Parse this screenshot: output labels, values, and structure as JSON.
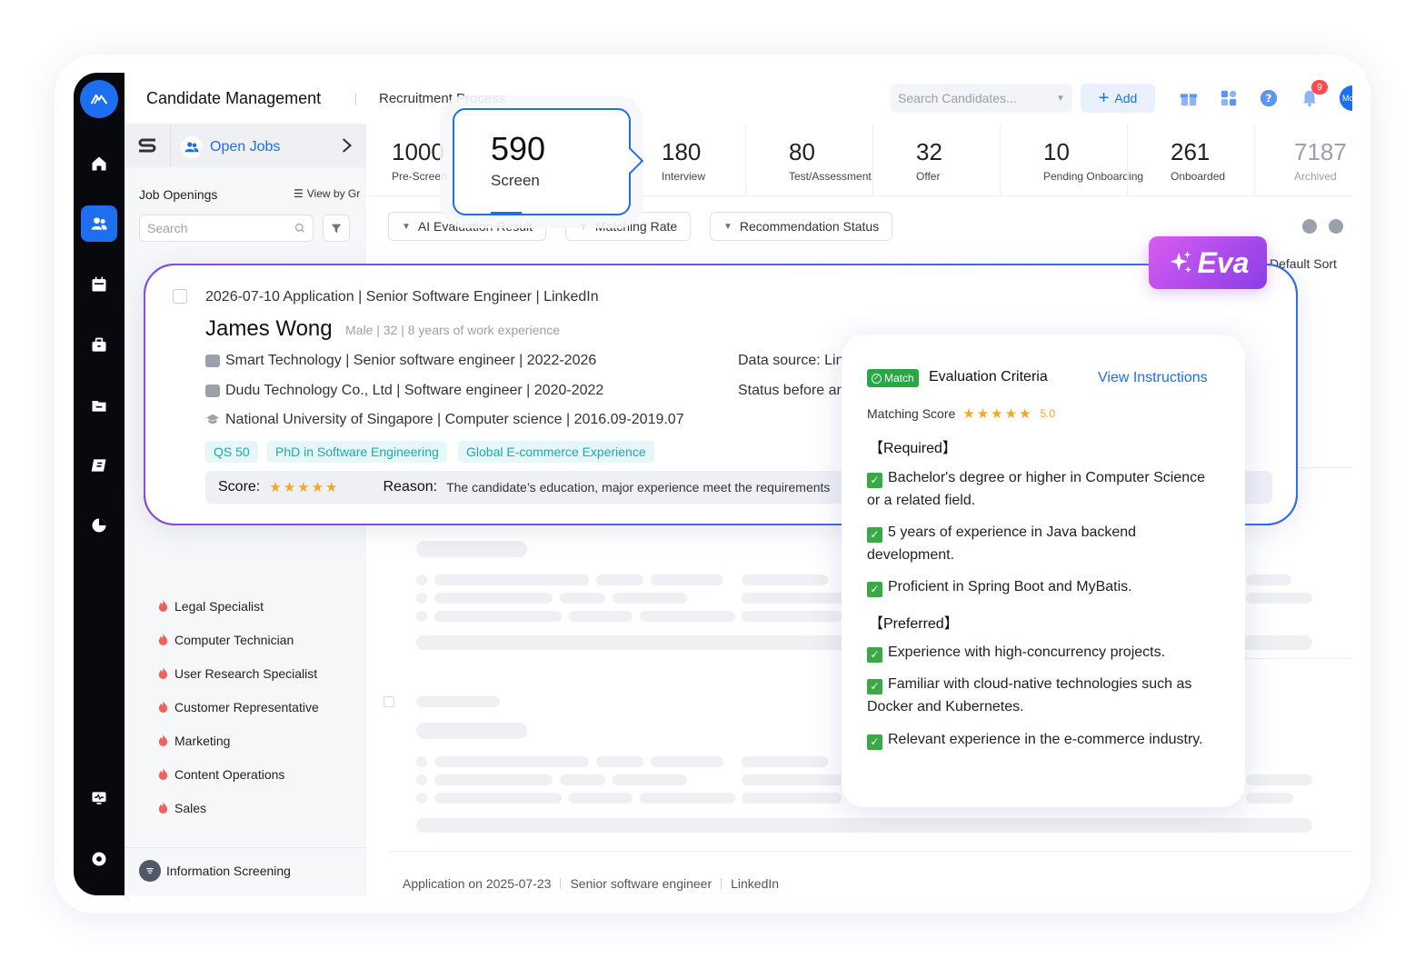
{
  "header": {
    "title": "Candidate Management",
    "tab": "Recruitment Process",
    "search_placeholder": "Search Candidates...",
    "add_label": "Add",
    "notification_count": "9",
    "avatar_text": "Mc"
  },
  "sidebar": {
    "open_jobs": "Open Jobs",
    "job_openings": "Job Openings",
    "view_by": "View by Gr",
    "search_placeholder": "Search",
    "jobs": [
      "Legal Specialist",
      "Computer Technician",
      "User Research Specialist",
      "Customer Representative",
      "Marketing",
      "Content Operations",
      "Sales"
    ],
    "bottom_label": "Information Screening"
  },
  "stages": [
    {
      "num": "1000",
      "label": "Pre-Screen"
    },
    {
      "num": "590",
      "label": "Screen"
    },
    {
      "num": "180",
      "label": "Interview"
    },
    {
      "num": "80",
      "label": "Test/Assessment"
    },
    {
      "num": "32",
      "label": "Offer"
    },
    {
      "num": "10",
      "label": "Pending Onboarding"
    },
    {
      "num": "261",
      "label": "Onboarded"
    },
    {
      "num": "7187",
      "label": "Archived"
    }
  ],
  "filters": [
    "AI Evaluation Result",
    "Matching Rate",
    "Recommendation Status"
  ],
  "default_sort": "Default Sort",
  "candidate": {
    "application": "2026-07-10 Application | Senior Software Engineer | LinkedIn",
    "name": "James Wong",
    "meta": "Male | 32 | 8 years of work experience",
    "experience": [
      "Smart Technology | Senior software engineer | 2022-2026",
      "Dudu Technology Co., Ltd | Software engineer | 2020-2022",
      "National University of Singapore | Computer science | 2016.09-2019.07"
    ],
    "data_source": "Data source: Linke",
    "status_before": "Status before arc",
    "tags": [
      "QS 50",
      "PhD in Software Engineering",
      "Global E-commerce Experience"
    ],
    "score_label": "Score:",
    "score_stars": 5,
    "reason_label": "Reason:",
    "reason_text": "The candidate’s education, major experience meet the requirements"
  },
  "eva": {
    "label": "Eva"
  },
  "evaluation": {
    "match_badge": "Match",
    "title": "Evaluation Criteria",
    "view_instructions": "View Instructions",
    "matching_score_label": "Matching Score",
    "matching_score_value": "5.0",
    "required_label": "【Required】",
    "required": [
      "Bachelor's degree or higher in Computer Science or a related field.",
      "5 years of experience in Java backend development.",
      "Proficient in Spring Boot and MyBatis."
    ],
    "preferred_label": "【Preferred】",
    "preferred": [
      "Experience with high-concurrency projects.",
      "Familiar with cloud-native technologies such as Docker and Kubernetes.",
      "Relevant experience in the e-commerce industry."
    ]
  },
  "bottom_application": {
    "date": "Application on 2025-07-23",
    "role": "Senior software engineer",
    "source": "LinkedIn"
  },
  "colors": {
    "accent": "#1e6ef0",
    "eva_gradient_start": "#d85cf0",
    "eva_gradient_end": "#8a3ee8",
    "match_green": "#28a745"
  }
}
